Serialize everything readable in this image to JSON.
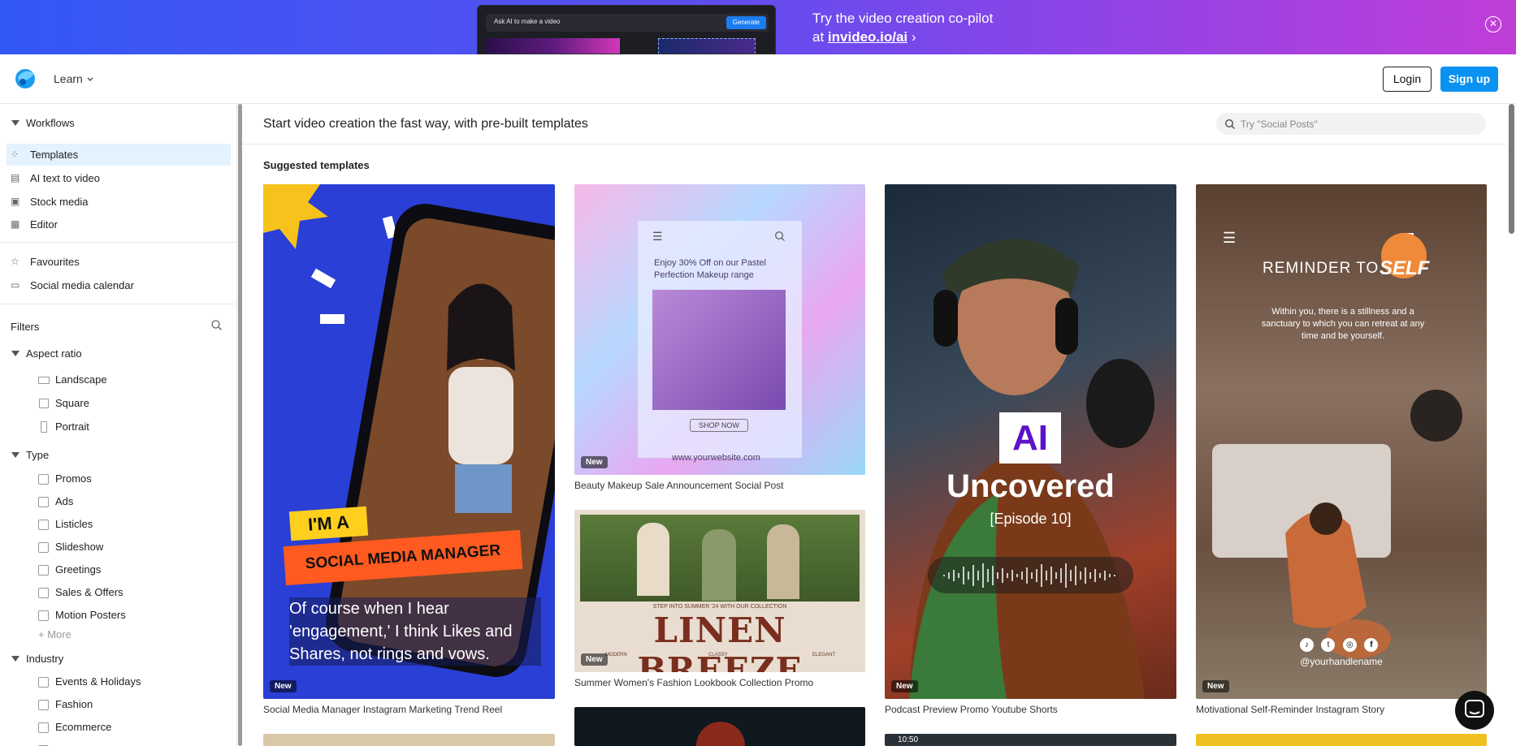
{
  "banner": {
    "ai_prompt_placeholder": "Ask AI to make a video",
    "generate_label": "Generate",
    "line1": "Try the video creation co-pilot",
    "line2_prefix": "at ",
    "link": "invideo.io/ai",
    "arrow": "›",
    "close": "✕"
  },
  "topbar": {
    "learn_label": "Learn",
    "login_label": "Login",
    "signup_label": "Sign up"
  },
  "sidebar": {
    "workflows_label": "Workflows",
    "items": [
      {
        "label": "Templates",
        "icon": "templates-icon",
        "active": true
      },
      {
        "label": "AI text to video",
        "icon": "ai-text-icon"
      },
      {
        "label": "Stock media",
        "icon": "stock-media-icon"
      },
      {
        "label": "Editor",
        "icon": "editor-icon"
      }
    ],
    "favourites_label": "Favourites",
    "calendar_label": "Social media calendar",
    "filters_label": "Filters",
    "aspect_ratio_label": "Aspect ratio",
    "aspect_options": [
      "Landscape",
      "Square",
      "Portrait"
    ],
    "type_label": "Type",
    "type_options": [
      "Promos",
      "Ads",
      "Listicles",
      "Slideshow",
      "Greetings",
      "Sales & Offers",
      "Motion Posters"
    ],
    "more_label": "More",
    "industry_label": "Industry",
    "industry_options": [
      "Events & Holidays",
      "Fashion",
      "Ecommerce"
    ]
  },
  "main": {
    "title": "Start video creation the fast way, with pre-built templates",
    "search_placeholder": "Try \"Social Posts\"",
    "suggested_label": "Suggested templates",
    "new_badge": "New",
    "cards": [
      {
        "caption": "Social Media Manager Instagram Marketing Trend Reel",
        "overlay_1": "I'M A",
        "overlay_2": "SOCIAL MEDIA MANAGER",
        "overlay_3": "Of course when I hear 'engagement,' I think Likes and Shares, not rings and vows."
      },
      {
        "caption": "Beauty Makeup Sale Announcement Social Post",
        "overlay_1": "Enjoy 30% Off on our Pastel Perfection Makeup range",
        "overlay_2": "SHOP NOW",
        "overlay_3": "www.yourwebsite.com"
      },
      {
        "caption": "Summer Women's Fashion Lookbook Collection Promo",
        "overlay_1": "STEP INTO SUMMER '24 WITH OUR COLLECTION",
        "overlay_2": "LINEN BREEZE",
        "overlay_3": "MODERN",
        "overlay_4": "CLASSY",
        "overlay_5": "ELEGANT"
      },
      {
        "caption": "Podcast Preview Promo Youtube Shorts",
        "overlay_1": "AI",
        "overlay_2": "Uncovered",
        "overlay_3": "[Episode 10]"
      },
      {
        "caption": "Motivational Self-Reminder Instagram Story",
        "overlay_1": "REMINDER TO",
        "overlay_2": "SELF",
        "overlay_3": "Within you, there is a stillness and a sanctuary to which you can retreat at any time and be yourself.",
        "overlay_4": "@yourhandlename"
      }
    ],
    "partial_card_text": "10:50"
  },
  "colors": {
    "accent": "#0a92f0",
    "active_bg": "#e3f2fd"
  }
}
